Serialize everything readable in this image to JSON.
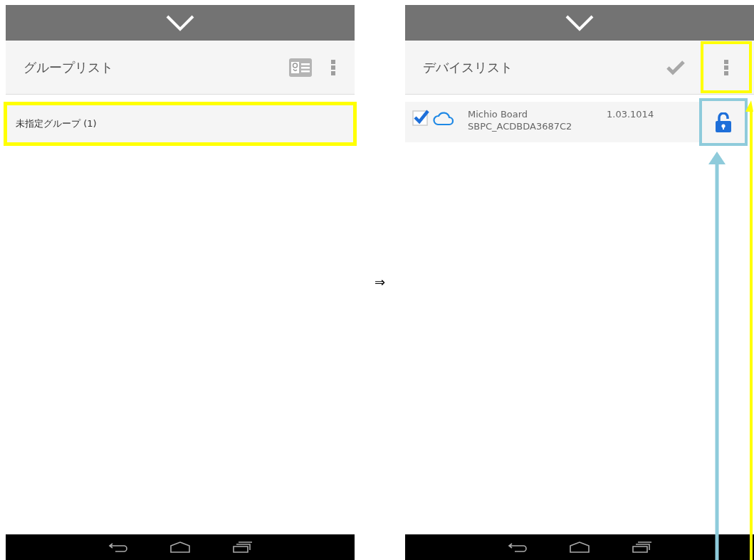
{
  "screens": [
    {
      "kind": "group_list",
      "title": "グループリスト",
      "groups": [
        {
          "label": "未指定グループ (1)",
          "highlight": {
            "color": "#ffff00"
          }
        }
      ]
    },
    {
      "kind": "device_list",
      "title": "デバイスリスト",
      "menu_highlight": {
        "color": "#ffff00"
      },
      "devices": [
        {
          "name": "Michio Board",
          "id": "SBPC_ACDBDA3687C2",
          "version": "1.03.1014",
          "checked": true,
          "lock_highlight": {
            "color": "#8ecbdb"
          }
        }
      ]
    }
  ],
  "transition": "⇒"
}
